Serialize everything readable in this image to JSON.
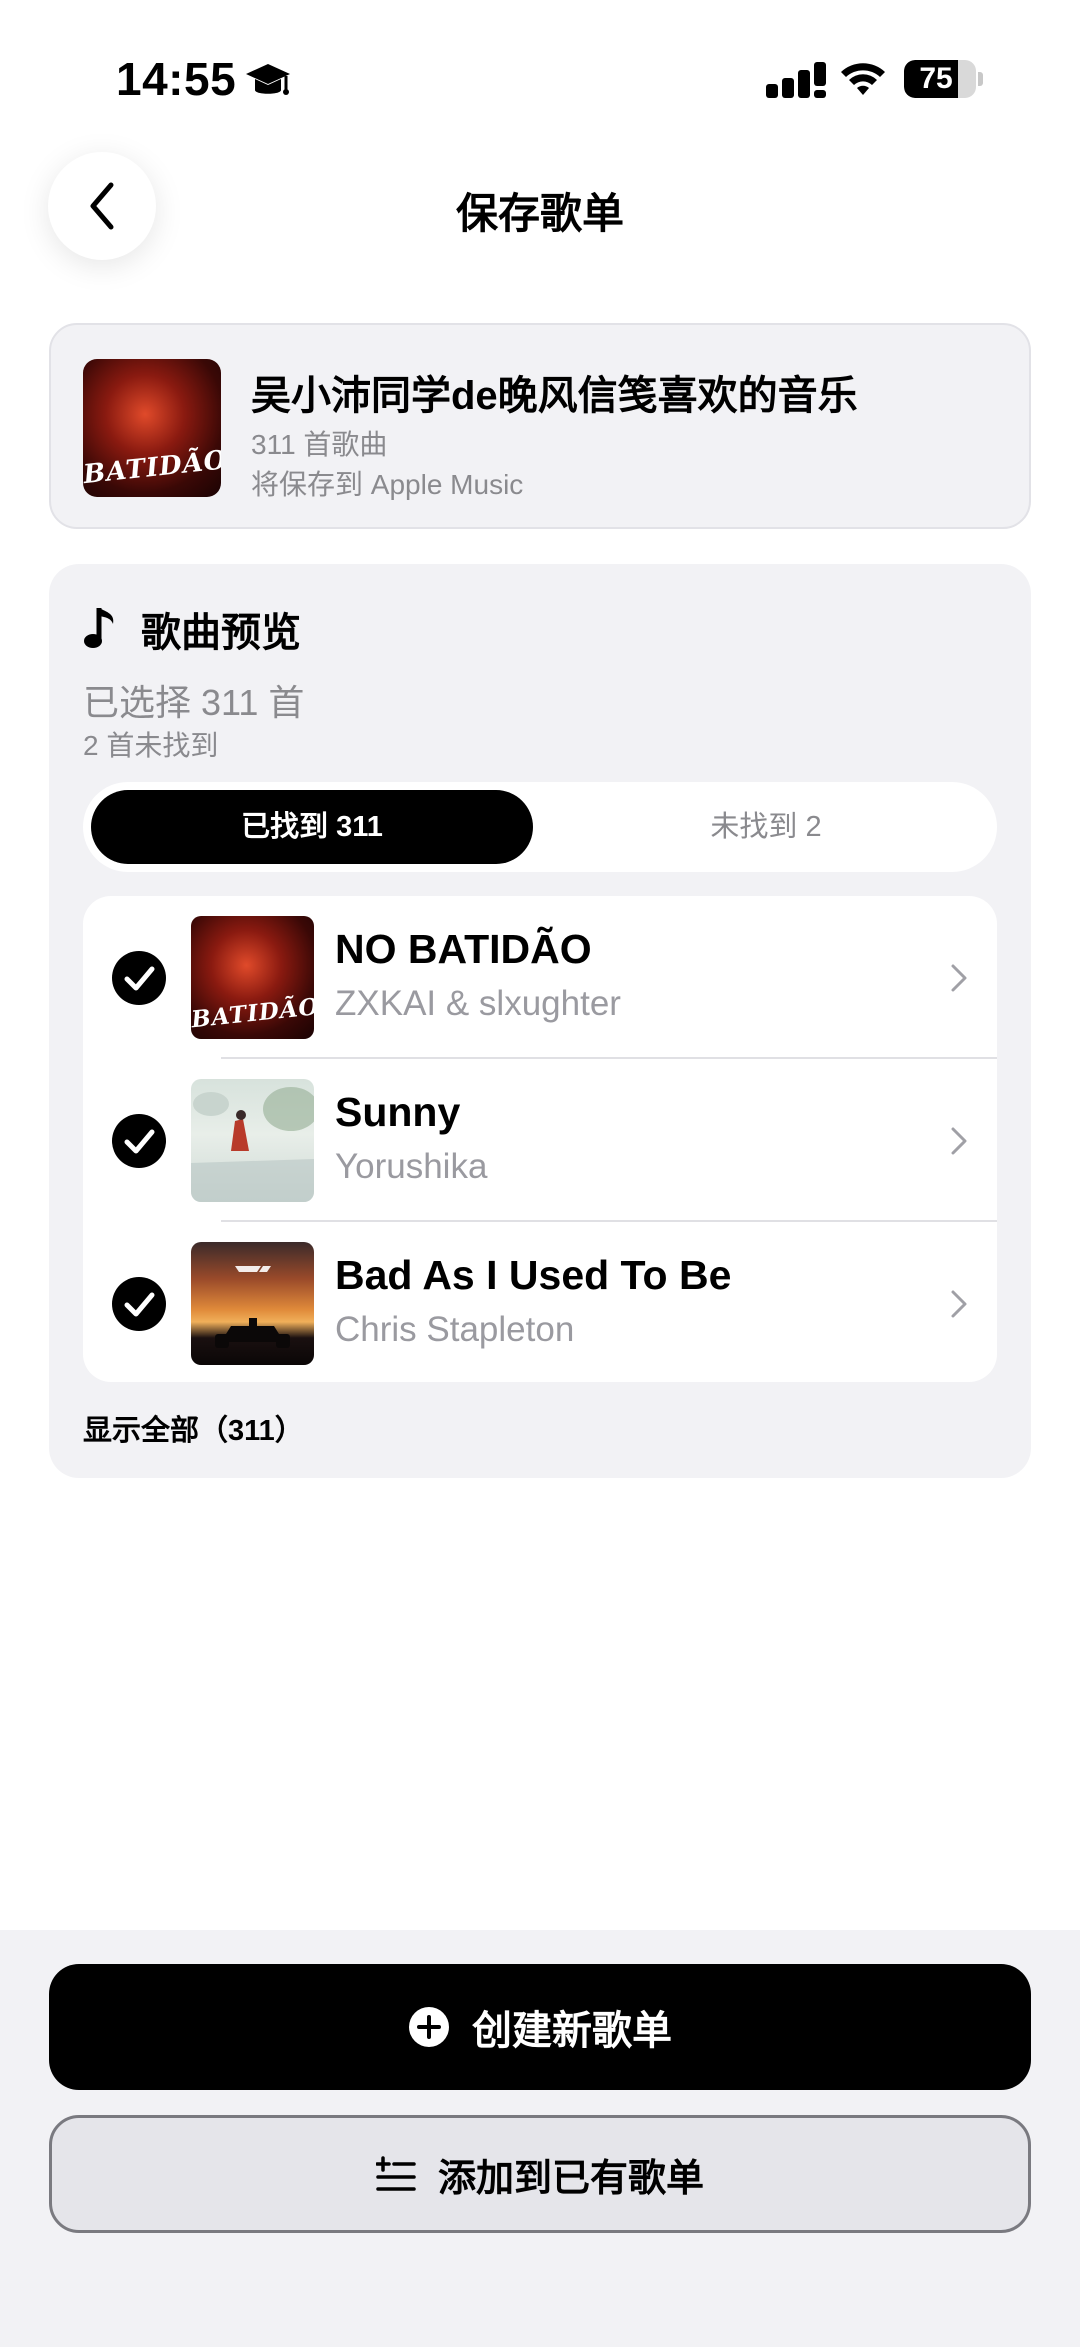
{
  "status_bar": {
    "time": "14:55",
    "battery_level": "75",
    "battery_fraction": 0.75
  },
  "header": {
    "title": "保存歌单"
  },
  "playlist": {
    "name": "吴小沛同学de晚风信笺喜欢的音乐",
    "count_text": "311 首歌曲",
    "destination_text": "将保存到 Apple Music",
    "cover_text": "BATIDÃO"
  },
  "preview": {
    "title": "歌曲预览",
    "selected_text": "已选择 311 首",
    "missing_text": "2 首未找到",
    "tabs": [
      {
        "label": "已找到 311",
        "active": true
      },
      {
        "label": "未找到 2",
        "active": false
      }
    ],
    "songs": [
      {
        "title": "NO BATIDÃO",
        "artist": "ZXKAI & slxughter",
        "checked": true,
        "cover": "batidao",
        "cover_text": "BATIDÃO"
      },
      {
        "title": "Sunny",
        "artist": "Yorushika",
        "checked": true,
        "cover": "sunny"
      },
      {
        "title": "Bad As I Used To Be",
        "artist": "Chris Stapleton",
        "checked": true,
        "cover": "f1"
      }
    ],
    "show_all_label": "显示全部（311）"
  },
  "actions": {
    "create_label": "创建新歌单",
    "add_existing_label": "添加到已有歌单"
  },
  "colors": {
    "background": "#ffffff",
    "card": "#f2f2f5",
    "secondary_text": "#8a8a8e",
    "accent": "#000000"
  }
}
